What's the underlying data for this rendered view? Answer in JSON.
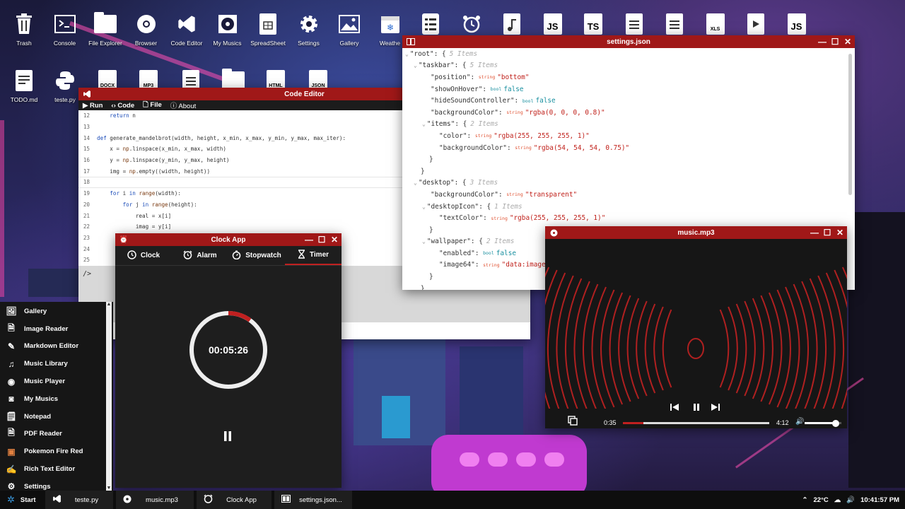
{
  "desktop": {
    "row1": [
      {
        "label": "Trash",
        "icon": "trash-icon"
      },
      {
        "label": "Console",
        "icon": "console-icon"
      },
      {
        "label": "File Explorer",
        "icon": "folder-icon"
      },
      {
        "label": "Browser",
        "icon": "chrome-icon"
      },
      {
        "label": "Code Editor",
        "icon": "vscode-icon"
      },
      {
        "label": "My Musics",
        "icon": "disc-icon"
      },
      {
        "label": "SpreadSheet",
        "icon": "spreadsheet-icon"
      },
      {
        "label": "Settings",
        "icon": "gear-icon"
      },
      {
        "label": "Gallery",
        "icon": "image-icon"
      },
      {
        "label": "Weathe",
        "icon": "calendar-snow-icon"
      },
      {
        "label": "",
        "icon": "list-icon"
      },
      {
        "label": "",
        "icon": "alarm-icon"
      },
      {
        "label": "",
        "icon": "music-file-icon"
      },
      {
        "label": "",
        "icon": "js-file-icon"
      },
      {
        "label": "",
        "icon": "ts-file-icon"
      },
      {
        "label": "",
        "icon": "doc-file-icon"
      },
      {
        "label": "",
        "icon": "doc-file-icon"
      },
      {
        "label": "",
        "icon": "xls-file-icon"
      },
      {
        "label": "",
        "icon": "video-file-icon"
      },
      {
        "label": "",
        "icon": "js-file-icon"
      }
    ],
    "row2": [
      {
        "label": "TODO.md",
        "icon": "markdown-file-icon"
      },
      {
        "label": "teste.py",
        "icon": "python-icon"
      },
      {
        "label": "",
        "tag": "DOCX"
      },
      {
        "label": "",
        "tag": "MP3"
      },
      {
        "label": "",
        "tag": ""
      },
      {
        "label": "",
        "tag": ""
      },
      {
        "label": "",
        "tag": "HTML"
      },
      {
        "label": "",
        "tag": "JSON"
      }
    ],
    "icon_tags": {
      "ts": "TS",
      "js": "JS",
      "xls": "XLS"
    }
  },
  "code_editor": {
    "title": "Code Editor",
    "menu": {
      "run": "Run",
      "code": "Code",
      "file": "File",
      "about": "About"
    },
    "lines": [
      {
        "n": "12",
        "code": "    return n"
      },
      {
        "n": "13",
        "code": ""
      },
      {
        "n": "14",
        "code": "def generate_mandelbrot(width, height, x_min, x_max, y_min, y_max, max_iter):"
      },
      {
        "n": "15",
        "code": "    x = np.linspace(x_min, x_max, width)"
      },
      {
        "n": "16",
        "code": "    y = np.linspace(y_min, y_max, height)"
      },
      {
        "n": "17",
        "code": "    img = np.empty((width, height))"
      },
      {
        "n": "18",
        "code": ""
      },
      {
        "n": "19",
        "code": "    for i in range(width):"
      },
      {
        "n": "20",
        "code": "        for j in range(height):"
      },
      {
        "n": "21",
        "code": "            real = x[i]"
      },
      {
        "n": "22",
        "code": "            imag = y[i]"
      },
      {
        "n": "23",
        "code": ""
      },
      {
        "n": "24",
        "code": ""
      },
      {
        "n": "25",
        "code": ""
      }
    ],
    "terminal_prompt": "/>"
  },
  "settings_json": {
    "title": "settings.json",
    "rows": [
      {
        "indent": 0,
        "caret": "⌄",
        "key": "\"root\"",
        "open": ": {",
        "count": "5 Items"
      },
      {
        "indent": 1,
        "caret": "⌄",
        "key": "\"taskbar\"",
        "open": ": {",
        "count": "5 Items"
      },
      {
        "indent": 2,
        "key": "\"position\"",
        "type": "string",
        "value": "\"bottom\""
      },
      {
        "indent": 2,
        "key": "\"showOnHover\"",
        "type": "bool",
        "value": "false"
      },
      {
        "indent": 2,
        "key": "\"hideSoundController\"",
        "type": "bool",
        "value": "false"
      },
      {
        "indent": 2,
        "key": "\"backgroundColor\"",
        "type": "string",
        "value": "\"rgba(0, 0, 0, 0.8)\""
      },
      {
        "indent": 2,
        "caret": "⌄",
        "key": "\"items\"",
        "open": ": {",
        "count": "2 Items"
      },
      {
        "indent": 3,
        "key": "\"color\"",
        "type": "string",
        "value": "\"rgba(255, 255, 255, 1)\""
      },
      {
        "indent": 3,
        "key": "\"backgroundColor\"",
        "type": "string",
        "value": "\"rgba(54, 54, 54, 0.75)\""
      },
      {
        "indent": 2,
        "close": "}"
      },
      {
        "indent": 1,
        "close": "}"
      },
      {
        "indent": 1,
        "caret": "⌄",
        "key": "\"desktop\"",
        "open": ": {",
        "count": "3 Items"
      },
      {
        "indent": 2,
        "key": "\"backgroundColor\"",
        "type": "string",
        "value": "\"transparent\""
      },
      {
        "indent": 2,
        "caret": "⌄",
        "key": "\"desktopIcon\"",
        "open": ": {",
        "count": "1 Items"
      },
      {
        "indent": 3,
        "key": "\"textColor\"",
        "type": "string",
        "value": "\"rgba(255, 255, 255, 1)\""
      },
      {
        "indent": 2,
        "close": "}"
      },
      {
        "indent": 2,
        "caret": "⌄",
        "key": "\"wallpaper\"",
        "open": ": {",
        "count": "2 Items"
      },
      {
        "indent": 3,
        "key": "\"enabled\"",
        "type": "bool",
        "value": "false"
      },
      {
        "indent": 3,
        "key": "\"image64\"",
        "type": "string",
        "value": "\"data:image/"
      },
      {
        "indent": 2,
        "close": "}"
      },
      {
        "indent": 1,
        "close": "}"
      }
    ]
  },
  "clock_app": {
    "title": "Clock App",
    "tabs": [
      {
        "label": "Clock",
        "icon": "clock-icon"
      },
      {
        "label": "Alarm",
        "icon": "alarm-icon"
      },
      {
        "label": "Stopwatch",
        "icon": "stopwatch-icon"
      },
      {
        "label": "Timer",
        "icon": "hourglass-icon",
        "active": true
      }
    ],
    "timer_display": "00:05:26",
    "progress": 0.1
  },
  "music_player": {
    "title": "music.mp3",
    "elapsed": "0:35",
    "total": "4:12",
    "progress": 0.14,
    "volume": 0.85
  },
  "start_menu": {
    "items": [
      {
        "label": "Gallery",
        "icon": "image-icon"
      },
      {
        "label": "Image Reader",
        "icon": "image-file-icon"
      },
      {
        "label": "Markdown Editor",
        "icon": "markdown-icon"
      },
      {
        "label": "Music Library",
        "icon": "music-library-icon"
      },
      {
        "label": "Music Player",
        "icon": "disc-icon"
      },
      {
        "label": "My Musics",
        "icon": "my-musics-icon"
      },
      {
        "label": "Notepad",
        "icon": "notepad-icon"
      },
      {
        "label": "PDF Reader",
        "icon": "pdf-icon"
      },
      {
        "label": "Pokemon Fire Red",
        "icon": "pokemon-icon"
      },
      {
        "label": "Rich Text Editor",
        "icon": "rich-text-icon"
      },
      {
        "label": "Settings",
        "icon": "gear-icon"
      }
    ]
  },
  "taskbar": {
    "start": "Start",
    "items": [
      {
        "label": "teste.py",
        "icon": "vscode-icon"
      },
      {
        "label": "music.mp3",
        "icon": "disc-icon"
      },
      {
        "label": "Clock App",
        "icon": "alarm-icon"
      },
      {
        "label": "settings.json...",
        "icon": "json-icon"
      }
    ],
    "temperature": "22°C",
    "time": "10:41:57 PM"
  },
  "colors": {
    "accent": "#a01818",
    "progress": "#c02020"
  }
}
